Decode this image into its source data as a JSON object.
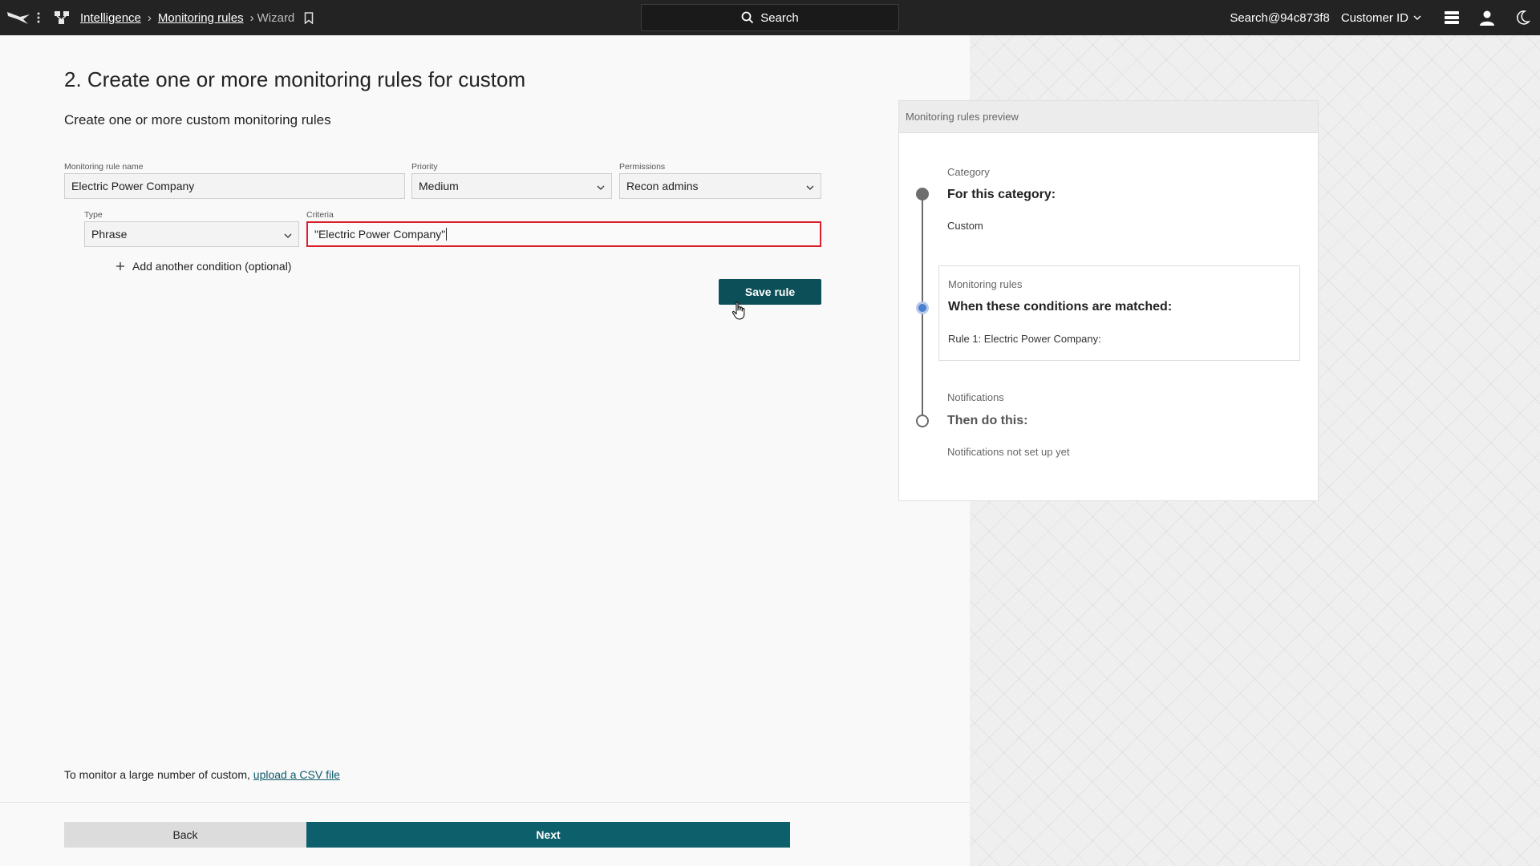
{
  "topbar": {
    "breadcrumb": {
      "intelligence": "Intelligence",
      "monitoring_rules": "Monitoring rules",
      "wizard": "Wizard"
    },
    "search_label": "Search",
    "user_email": "Search@94c873f8",
    "customer_id": "Customer ID"
  },
  "main": {
    "title": "2. Create one or more monitoring rules for custom",
    "subtitle": "Create one or more custom monitoring rules",
    "fields": {
      "rule_name_label": "Monitoring rule name",
      "rule_name_value": "Electric Power Company",
      "priority_label": "Priority",
      "priority_value": "Medium",
      "permissions_label": "Permissions",
      "permissions_value": "Recon admins",
      "type_label": "Type",
      "type_value": "Phrase",
      "criteria_label": "Criteria",
      "criteria_value": "\"Electric Power Company\""
    },
    "add_condition_label": "Add another condition (optional)",
    "save_rule_label": "Save rule",
    "csv_note_text": "To monitor a large number of custom,",
    "csv_link_text": "upload a CSV file",
    "back_label": "Back",
    "next_label": "Next"
  },
  "preview": {
    "header": "Monitoring rules preview",
    "category_label": "Category",
    "category_heading": "For this category:",
    "category_value": "Custom",
    "rules_label": "Monitoring rules",
    "rules_heading": "When these conditions are matched:",
    "rule_1": "Rule 1: Electric Power Company:",
    "notifications_label": "Notifications",
    "notifications_heading": "Then do this:",
    "notifications_value": "Notifications not set up yet"
  },
  "colors": {
    "topbar_bg": "#232323",
    "primary_button": "#0d4f58",
    "next_button": "#0d5f6b",
    "error_border": "#d9202a",
    "active_step": "#4a7fd1"
  },
  "icons": [
    "falcon-logo-icon",
    "apps-grid-icon",
    "network-icon",
    "bookmark-icon",
    "search-icon",
    "chevron-down-icon",
    "messages-icon",
    "user-icon",
    "moon-icon",
    "plus-icon",
    "hand-cursor-icon"
  ]
}
